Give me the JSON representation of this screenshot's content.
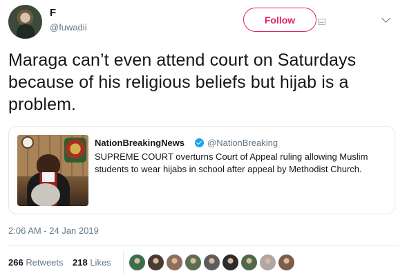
{
  "author": {
    "name": "F",
    "handle": "@fuwadii"
  },
  "actions": {
    "follow_label": "Follow"
  },
  "tweet": {
    "text": "Maraga can’t even attend court on Saturdays because of his religious beliefs but hijab is a problem.",
    "timestamp": "2:06 AM - 24 Jan 2019"
  },
  "quoted": {
    "name": "NationBreakingNews",
    "handle": "@NationBreaking",
    "text": "SUPREME COURT overturns Court of Appeal ruling allowing Muslim students to wear hijabs in  school after appeal by Methodist Church."
  },
  "stats": {
    "retweets_count": "266",
    "retweets_label": "Retweets",
    "likes_count": "218",
    "likes_label": "Likes"
  },
  "likers_colors": [
    "#3b6e4a",
    "#4a3a32",
    "#8c6f5c",
    "#5a6f52",
    "#5c5c5c",
    "#2c2c2c",
    "#4e6a48",
    "#b0a6a8",
    "#7a5e4a"
  ],
  "colors": {
    "follow_accent": "#e0245e",
    "verified": "#1da1f2",
    "secondary_text": "#657786"
  }
}
